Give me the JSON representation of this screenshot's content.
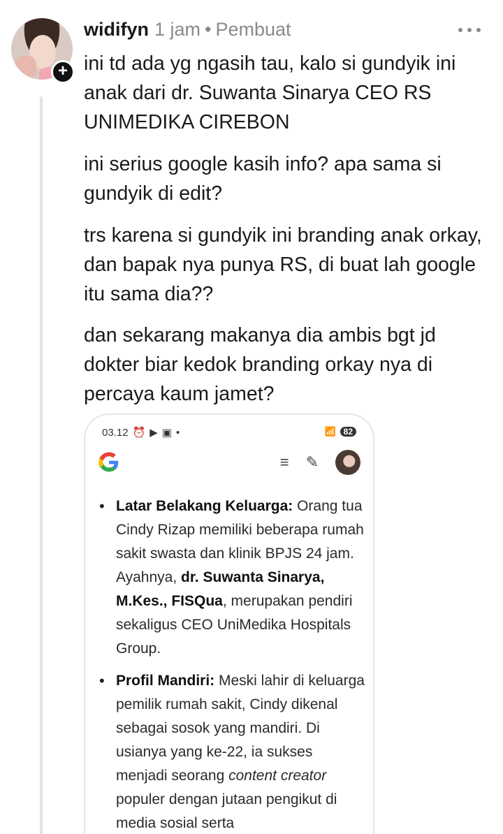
{
  "post": {
    "username": "widifyn",
    "time": "1 jam",
    "separator": "•",
    "role": "Pembuat",
    "paragraphs": [
      "ini td ada yg ngasih tau, kalo si gundyik ini anak dari dr. Suwanta Sinarya CEO RS UNIMEDIKA CIREBON",
      "ini serius google kasih info? apa sama si gundyik di edit?",
      "trs karena si gundyik ini branding anak orkay, dan  bapak nya punya RS, di buat lah google itu sama dia??",
      "dan sekarang makanya dia ambis bgt jd dokter biar kedok branding orkay nya di percaya kaum jamet?"
    ]
  },
  "embed": {
    "status_time": "03.12",
    "status_dot": "•",
    "battery": "82",
    "bullet1": {
      "label": "Latar Belakang Keluarga:",
      "text1": " Orang tua Cindy Rizap memiliki beberapa rumah sakit swasta dan klinik BPJS 24 jam. Ayahnya, ",
      "bold2": "dr. Suwanta Sinarya, M.Kes., FISQua",
      "text2": ", merupakan pendiri sekaligus CEO UniMedika Hospitals Group."
    },
    "bullet2": {
      "label": "Profil Mandiri:",
      "text1": " Meski lahir di keluarga pemilik rumah sakit, Cindy dikenal sebagai sosok yang mandiri. Di usianya yang ke-22, ia sukses menjadi seorang ",
      "italic": "content creator",
      "text2": " populer dengan jutaan pengikut di media sosial serta"
    }
  },
  "icons": {
    "more": "more-horizontal-icon",
    "follow": "plus-icon",
    "google": "google-logo-icon",
    "list": "list-sparkle-icon",
    "edit": "edit-icon"
  },
  "colors": {
    "text": "#1a1a1a",
    "meta": "#8a8a8a",
    "thread_line": "#e4e4e4"
  }
}
